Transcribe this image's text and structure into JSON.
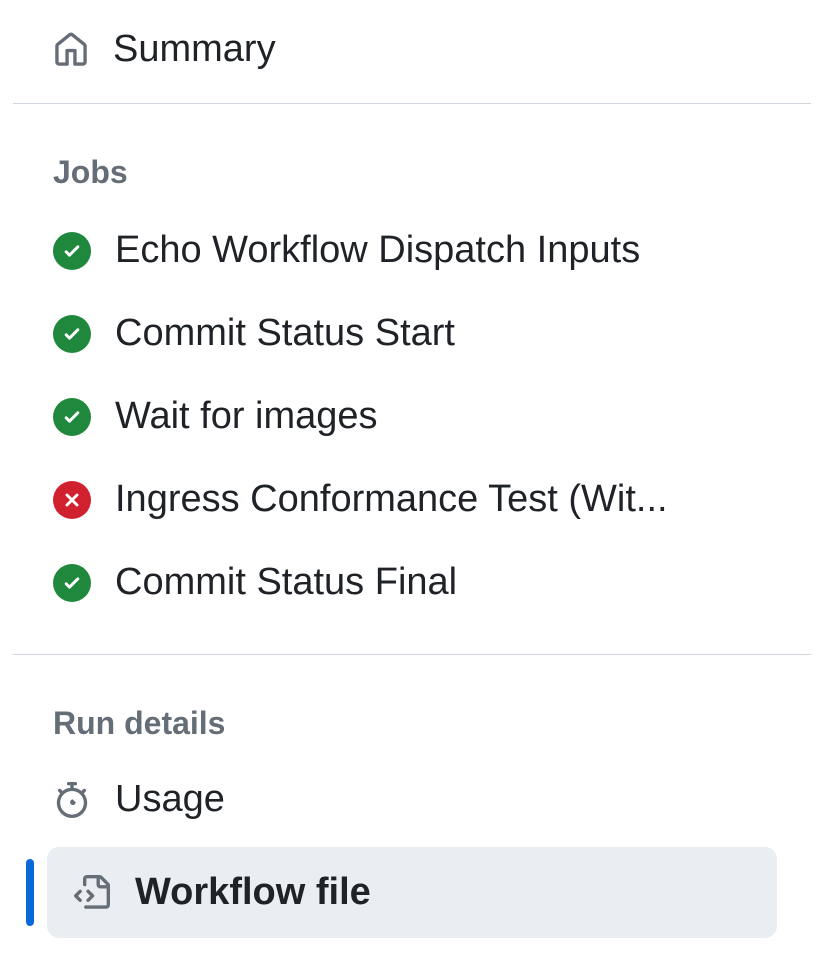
{
  "summary": {
    "label": "Summary"
  },
  "jobs": {
    "heading": "Jobs",
    "items": [
      {
        "label": "Echo Workflow Dispatch Inputs",
        "status": "success"
      },
      {
        "label": "Commit Status Start",
        "status": "success"
      },
      {
        "label": "Wait for images",
        "status": "success"
      },
      {
        "label": "Ingress Conformance Test (Wit...",
        "status": "failure"
      },
      {
        "label": "Commit Status Final",
        "status": "success"
      }
    ]
  },
  "runDetails": {
    "heading": "Run details",
    "usage": {
      "label": "Usage"
    },
    "workflowFile": {
      "label": "Workflow file"
    }
  }
}
